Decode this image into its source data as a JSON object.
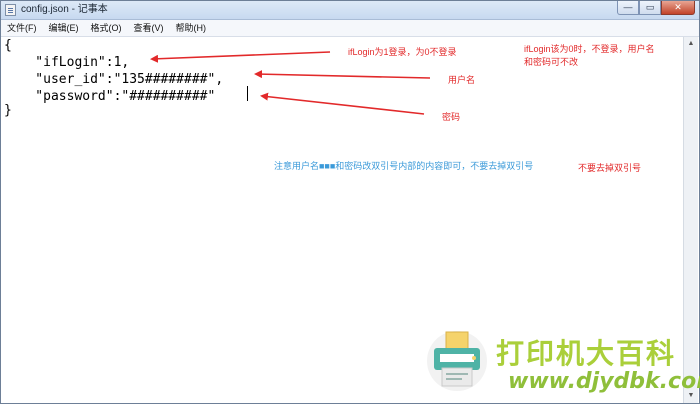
{
  "window": {
    "title": "config.json - 记事本",
    "minimize": "—",
    "maximize": "▭",
    "close": "✕"
  },
  "menu": [
    "文件(F)",
    "编辑(E)",
    "格式(O)",
    "查看(V)",
    "帮助(H)"
  ],
  "editor": {
    "lines": [
      "{",
      "    \"ifLogin\":1,",
      "    \"user_id\":\"135########\",",
      "    \"password\":\"##########\"",
      "}"
    ]
  },
  "annotations": {
    "iflogin": "ifLogin为1登录，为0不登录",
    "iflogin_zero_1": "ifLogin该为0时，不登录，用户名",
    "iflogin_zero_2": "和密码可不改",
    "username": "用户名",
    "password": "密码",
    "notice_blue": "注意用户名■■■和密码改双引号内部的内容即可，不要去掉双引号",
    "notice_red": "不要去掉双引号"
  },
  "watermark": {
    "title": "打印机大百科",
    "url": "www.djydbk.com"
  },
  "colors": {
    "annotation_red": "#e2292a",
    "annotation_blue": "#3b9ad9",
    "watermark_green": "#aacf3a"
  }
}
